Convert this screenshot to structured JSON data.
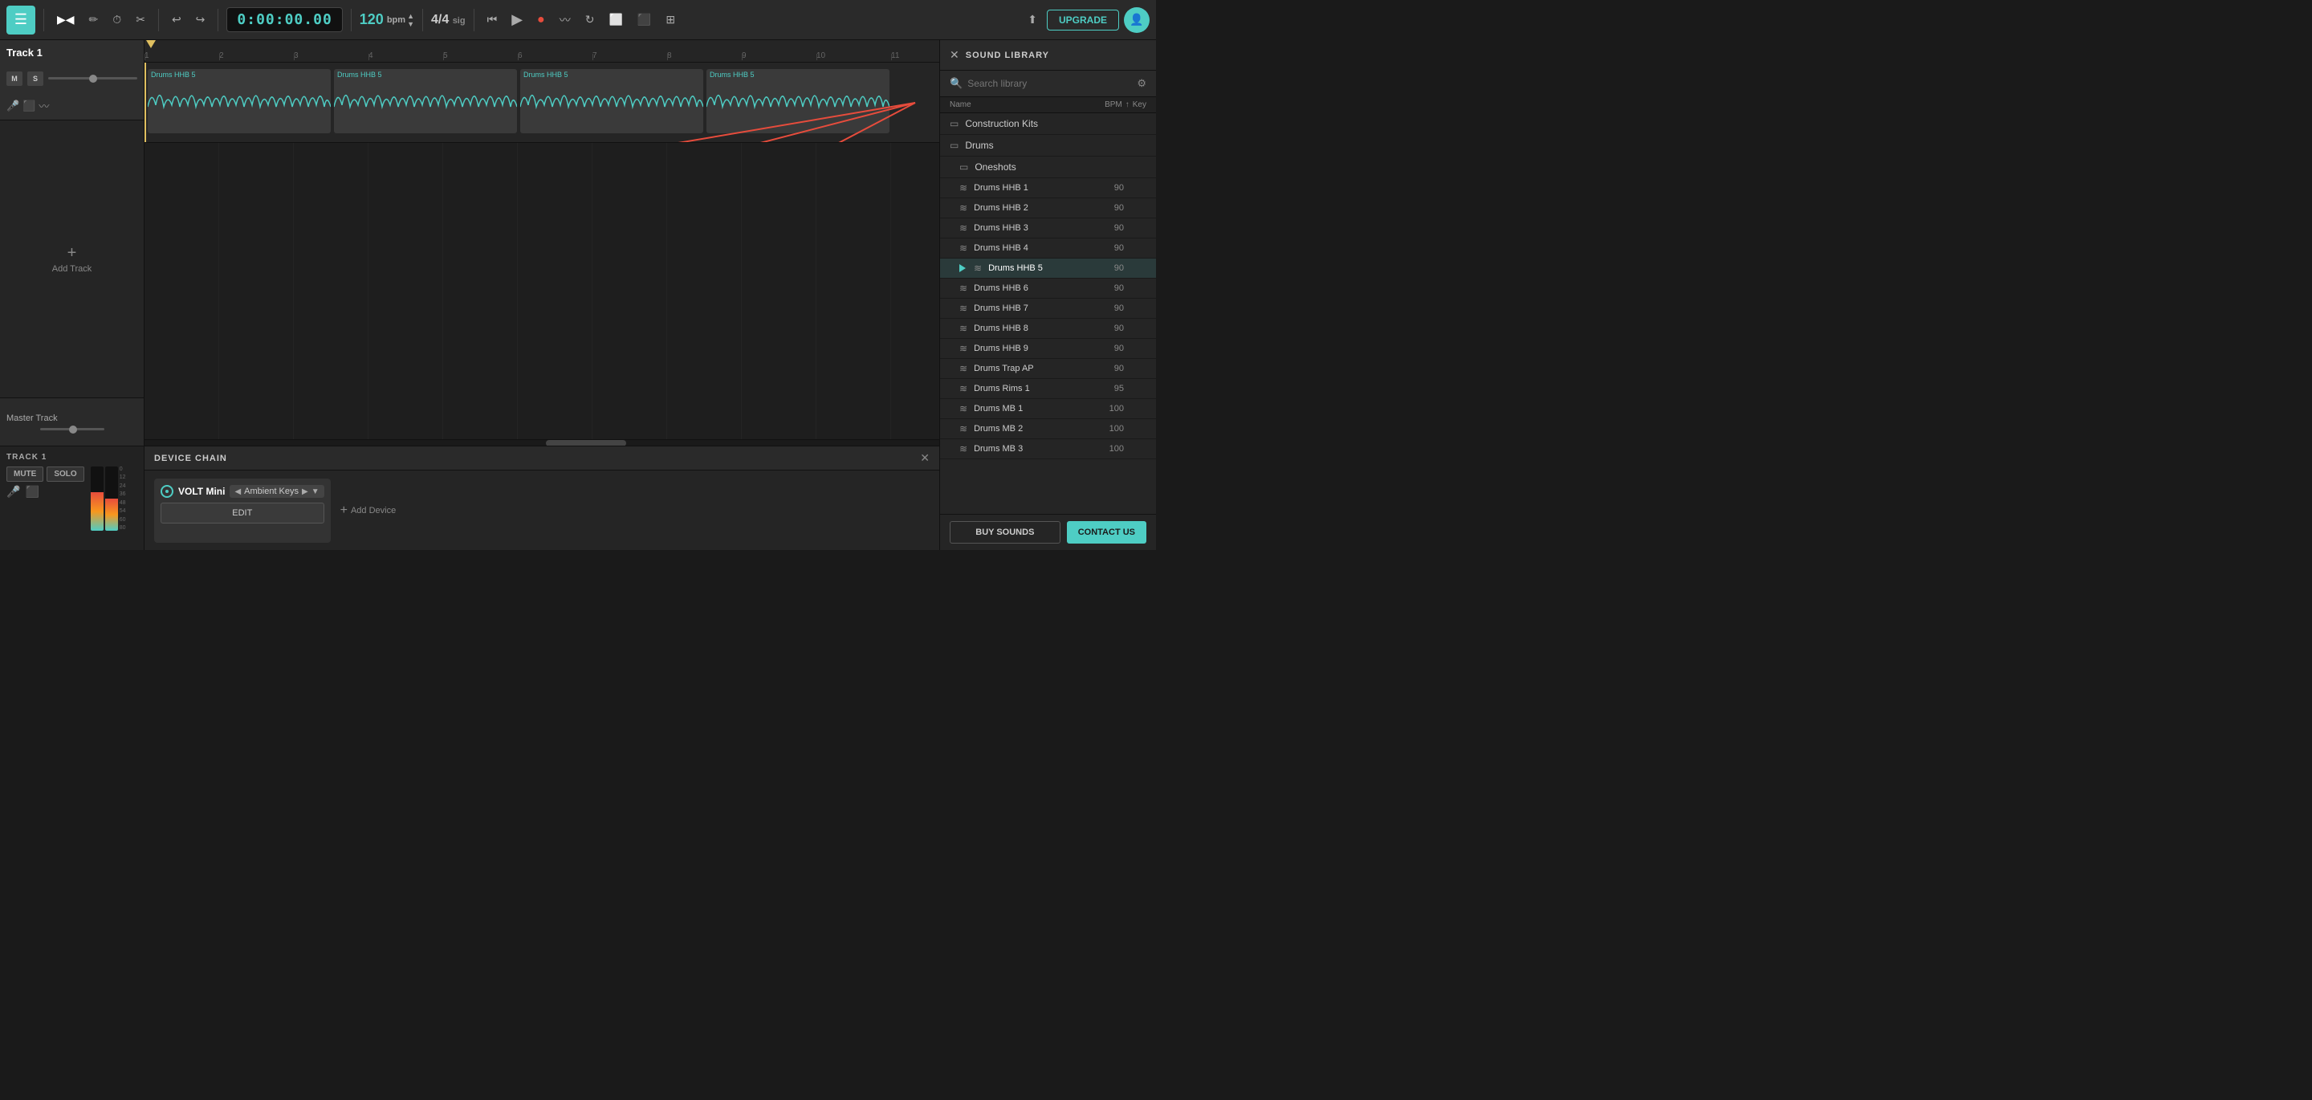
{
  "toolbar": {
    "time": "0:00:00.00",
    "bpm": "120",
    "bpm_label": "bpm",
    "sig_num": "4/4",
    "sig_label": "sig",
    "upgrade_label": "UPGRADE"
  },
  "track1": {
    "name": "Track 1",
    "mute_label": "M",
    "solo_label": "S",
    "add_track_label": "Add Track"
  },
  "master_track": {
    "name": "Master Track"
  },
  "bottom_track": {
    "label": "TRACK 1",
    "mute_label": "MUTE",
    "solo_label": "SOLO"
  },
  "waveform_blocks": [
    {
      "label": "Drums HHB 5",
      "left_pct": 0
    },
    {
      "label": "Drums HHB 5",
      "left_pct": 22
    },
    {
      "label": "Drums HHB 5",
      "left_pct": 44
    },
    {
      "label": "Drums HHB 5",
      "left_pct": 66
    }
  ],
  "device_chain": {
    "title": "DEVICE CHAIN",
    "device_name": "VOLT Mini",
    "preset_name": "Ambient Keys",
    "edit_label": "EDIT",
    "add_device_label": "Add Device",
    "close_label": "✕"
  },
  "sound_library": {
    "title": "SOUND LIBRARY",
    "search_placeholder": "Search library",
    "col_name": "Name",
    "col_bpm": "BPM",
    "col_sort": "↑",
    "col_key": "Key",
    "folders": [
      {
        "name": "Construction Kits"
      },
      {
        "name": "Drums"
      },
      {
        "name": "Oneshots"
      }
    ],
    "items": [
      {
        "name": "Drums HHB 1",
        "bpm": "90",
        "key": ""
      },
      {
        "name": "Drums HHB 2",
        "bpm": "90",
        "key": ""
      },
      {
        "name": "Drums HHB 3",
        "bpm": "90",
        "key": ""
      },
      {
        "name": "Drums HHB 4",
        "bpm": "90",
        "key": ""
      },
      {
        "name": "Drums HHB 5",
        "bpm": "90",
        "key": "",
        "active": true
      },
      {
        "name": "Drums HHB 6",
        "bpm": "90",
        "key": ""
      },
      {
        "name": "Drums HHB 7",
        "bpm": "90",
        "key": ""
      },
      {
        "name": "Drums HHB 8",
        "bpm": "90",
        "key": ""
      },
      {
        "name": "Drums HHB 9",
        "bpm": "90",
        "key": ""
      },
      {
        "name": "Drums Trap AP",
        "bpm": "90",
        "key": ""
      },
      {
        "name": "Drums Rims 1",
        "bpm": "95",
        "key": ""
      },
      {
        "name": "Drums MB 1",
        "bpm": "100",
        "key": ""
      },
      {
        "name": "Drums MB 2",
        "bpm": "100",
        "key": ""
      },
      {
        "name": "Drums MB 3",
        "bpm": "100",
        "key": ""
      }
    ],
    "buy_sounds_label": "BUY SOUNDS",
    "contact_label": "CONTACT US"
  },
  "ruler": {
    "marks": [
      "1",
      "2",
      "3",
      "4",
      "5",
      "6",
      "7",
      "8",
      "9",
      "10",
      "11"
    ]
  }
}
